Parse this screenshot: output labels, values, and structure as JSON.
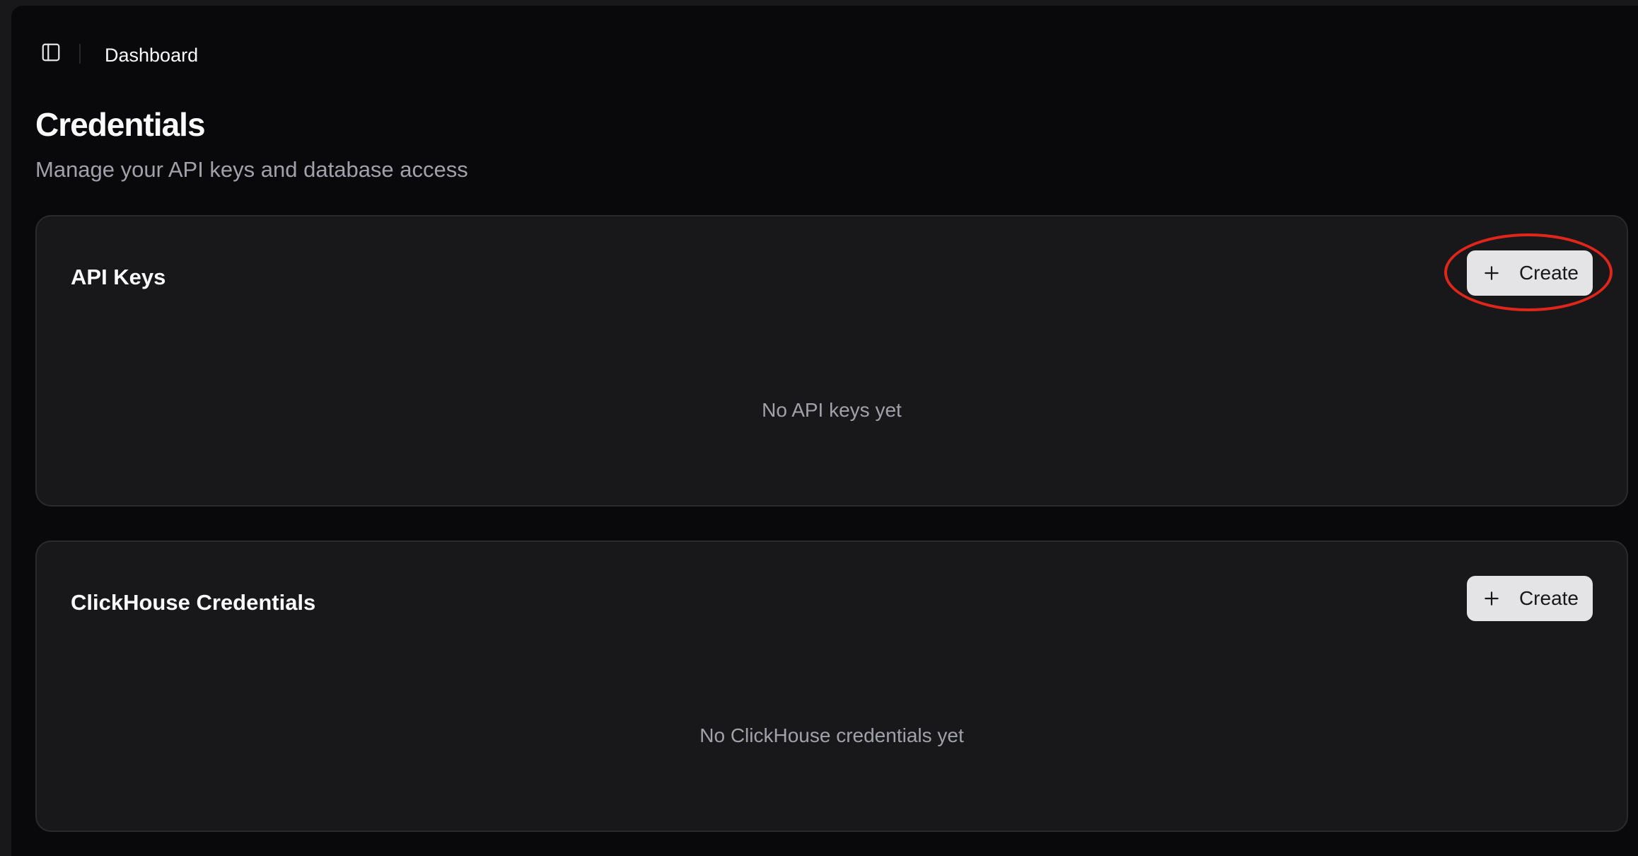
{
  "header": {
    "breadcrumb": "Dashboard",
    "sidebar_toggle_icon": "sidebar-toggle-icon"
  },
  "page": {
    "title": "Credentials",
    "subtitle": "Manage your API keys and database access"
  },
  "sections": {
    "api_keys": {
      "title": "API Keys",
      "create_label": "Create",
      "empty_text": "No API keys yet"
    },
    "clickhouse": {
      "title": "ClickHouse Credentials",
      "create_label": "Create",
      "empty_text": "No ClickHouse credentials yet"
    }
  },
  "colors": {
    "background": "#09090b",
    "card": "#18181b",
    "button": "#e4e4e7",
    "highlight": "#e0261b",
    "muted_text": "#a1a1aa"
  }
}
